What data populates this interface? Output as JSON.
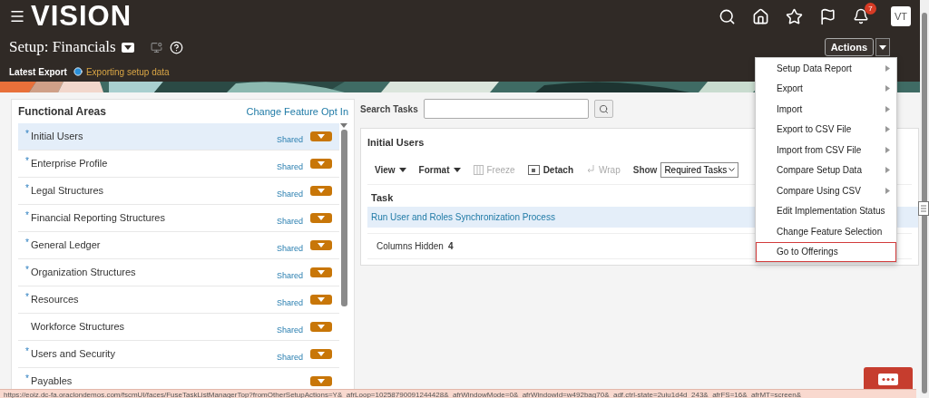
{
  "header": {
    "logo": "VISION",
    "notification_count": "7",
    "avatar": "VT"
  },
  "page": {
    "title": "Setup: Financials",
    "actions_button": "Actions"
  },
  "export_status": {
    "label": "Latest Export",
    "status": "Exporting setup data"
  },
  "functional_areas": {
    "title": "Functional Areas",
    "link": "Change Feature Opt In",
    "items": [
      {
        "marker": "*",
        "label": "Initial Users",
        "status": "Shared",
        "selected": true
      },
      {
        "marker": "*",
        "label": "Enterprise Profile",
        "status": "Shared",
        "selected": false
      },
      {
        "marker": "*",
        "label": "Legal Structures",
        "status": "Shared",
        "selected": false
      },
      {
        "marker": "*",
        "label": "Financial Reporting Structures",
        "status": "Shared",
        "selected": false
      },
      {
        "marker": "*",
        "label": "General Ledger",
        "status": "Shared",
        "selected": false
      },
      {
        "marker": "*",
        "label": "Organization Structures",
        "status": "Shared",
        "selected": false
      },
      {
        "marker": "*",
        "label": "Resources",
        "status": "Shared",
        "selected": false
      },
      {
        "label": "Workforce Structures",
        "status": "Shared",
        "selected": false
      },
      {
        "marker": "*",
        "label": "Users and Security",
        "status": "Shared",
        "selected": false
      },
      {
        "marker": "*",
        "label": "Payables",
        "selected": false
      }
    ]
  },
  "search": {
    "label": "Search Tasks"
  },
  "task_panel": {
    "title": "Initial Users",
    "toolbar": [
      {
        "label": "View",
        "kind": "menu",
        "disabled": false
      },
      {
        "label": "Format",
        "kind": "menu",
        "disabled": false
      },
      {
        "label": "Freeze",
        "kind": "freeze",
        "disabled": true
      },
      {
        "label": "Detach",
        "kind": "detach",
        "disabled": false
      },
      {
        "label": "Wrap",
        "kind": "wrap",
        "disabled": true
      }
    ],
    "show_label": "Show",
    "show_value": "Required Tasks",
    "column": "Task",
    "rows": [
      {
        "task": "Run User and Roles Synchronization Process",
        "selected": true
      }
    ],
    "columns_hidden_label": "Columns Hidden",
    "columns_hidden_count": "4"
  },
  "actions_menu": {
    "items": [
      {
        "label": "Setup Data Report",
        "submenu": true,
        "selected": false
      },
      {
        "label": "Export",
        "submenu": true,
        "selected": false
      },
      {
        "label": "Import",
        "submenu": true,
        "selected": false
      },
      {
        "label": "Export to CSV File",
        "submenu": true,
        "selected": false
      },
      {
        "label": "Import from CSV File",
        "submenu": true,
        "selected": false
      },
      {
        "label": "Compare Setup Data",
        "submenu": true,
        "selected": false
      },
      {
        "label": "Compare Using CSV",
        "submenu": true,
        "selected": false
      },
      {
        "label": "Edit Implementation Status",
        "submenu": false,
        "selected": false
      },
      {
        "label": "Change Feature Selection",
        "submenu": false,
        "selected": false
      },
      {
        "label": "Go to Offerings",
        "submenu": false,
        "selected": true
      }
    ]
  },
  "status_bar": {
    "url": "https://eoiz.dc-fa.oraclondemos.com/fscmUI/faces/FuseTaskListManagerTop?fromOtherSetupActions=Y&_afrLoop=10258790091244428&_afrWindowMode=0&_afrWindowId=w492bag70&_adf.ctrl-state=2uiu1d4d_243&_afrFS=16&_afrMT=screen&"
  }
}
